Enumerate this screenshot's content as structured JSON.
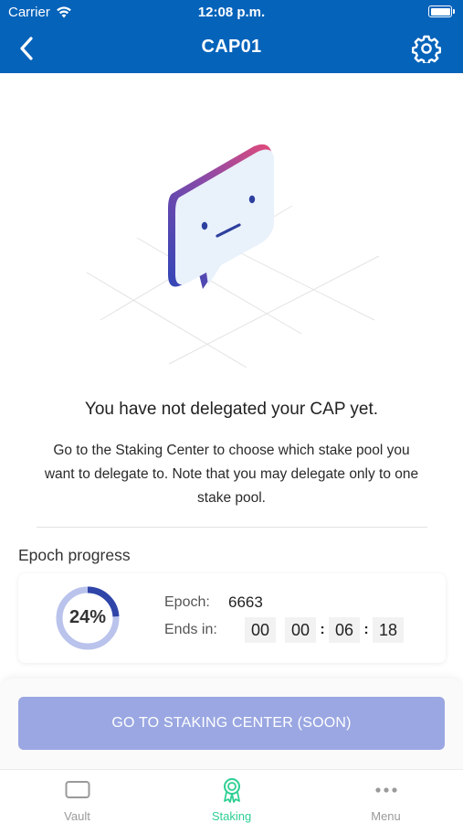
{
  "status_bar": {
    "carrier": "Carrier",
    "time": "12:08 p.m."
  },
  "header": {
    "title": "CAP01"
  },
  "empty_state": {
    "headline": "You have not delegated your CAP yet.",
    "description": "Go to the Staking Center to choose which stake pool you want to delegate to. Note that you may delegate only to one stake pool."
  },
  "epoch": {
    "section_label": "Epoch progress",
    "percent_text": "24%",
    "progress": 0.24,
    "epoch_label": "Epoch:",
    "epoch_value": "6663",
    "ends_label": "Ends in:",
    "countdown": [
      "00",
      "00",
      "06",
      "18"
    ]
  },
  "cta": {
    "label": "GO TO STAKING CENTER (SOON)"
  },
  "tabs": [
    {
      "label": "Vault",
      "icon": "vault-icon"
    },
    {
      "label": "Staking",
      "icon": "staking-icon",
      "active": true
    },
    {
      "label": "Menu",
      "icon": "more-dots-icon"
    }
  ],
  "colors": {
    "header_bg": "#0563ba",
    "cta_bg": "#9aa7e2",
    "tab_active": "#2ecf93",
    "ring_track": "#b9c3ec",
    "ring_fill": "#2f45a8"
  }
}
